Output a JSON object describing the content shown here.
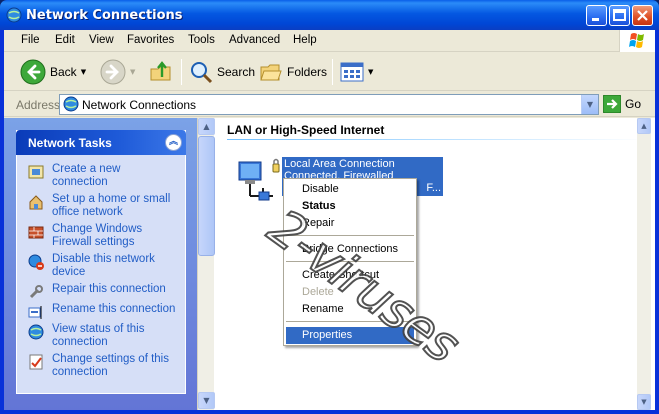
{
  "window": {
    "title": "Network Connections"
  },
  "menubar": {
    "items": [
      "File",
      "Edit",
      "View",
      "Favorites",
      "Tools",
      "Advanced",
      "Help"
    ]
  },
  "toolbar": {
    "back_label": "Back",
    "search_label": "Search",
    "folders_label": "Folders"
  },
  "addressbar": {
    "label": "Address",
    "value": "Network Connections",
    "go_label": "Go"
  },
  "taskpane": {
    "title": "Network Tasks",
    "items": [
      {
        "label": "Create a new connection",
        "icon": "new-connection-icon"
      },
      {
        "label": "Set up a home or small office network",
        "icon": "home-network-icon"
      },
      {
        "label": "Change Windows Firewall settings",
        "icon": "firewall-icon"
      },
      {
        "label": "Disable this network device",
        "icon": "disable-device-icon"
      },
      {
        "label": "Repair this connection",
        "icon": "repair-icon"
      },
      {
        "label": "Rename this connection",
        "icon": "rename-icon"
      },
      {
        "label": "View status of this connection",
        "icon": "status-icon"
      },
      {
        "label": "Change settings of this connection",
        "icon": "settings-icon"
      }
    ]
  },
  "main": {
    "group_header": "LAN or High-Speed Internet",
    "connection": {
      "name": "Local Area Connection",
      "status": "Connected, Firewalled",
      "device": "F..."
    }
  },
  "context_menu": {
    "items": [
      {
        "label": "Disable",
        "style": "normal"
      },
      {
        "label": "Status",
        "style": "bold"
      },
      {
        "label": "Repair",
        "style": "normal"
      },
      {
        "label": "Bridge Connections",
        "style": "normal"
      },
      {
        "label": "Create Shortcut",
        "style": "normal"
      },
      {
        "label": "Delete",
        "style": "disabled"
      },
      {
        "label": "Rename",
        "style": "normal"
      },
      {
        "label": "Properties",
        "style": "selected"
      }
    ]
  },
  "watermark": {
    "text": "2-viruses"
  },
  "colors": {
    "title_bar": "#0046d5",
    "selection": "#316ac5",
    "link": "#215dc6",
    "taskpane": "#7ba2e7"
  }
}
